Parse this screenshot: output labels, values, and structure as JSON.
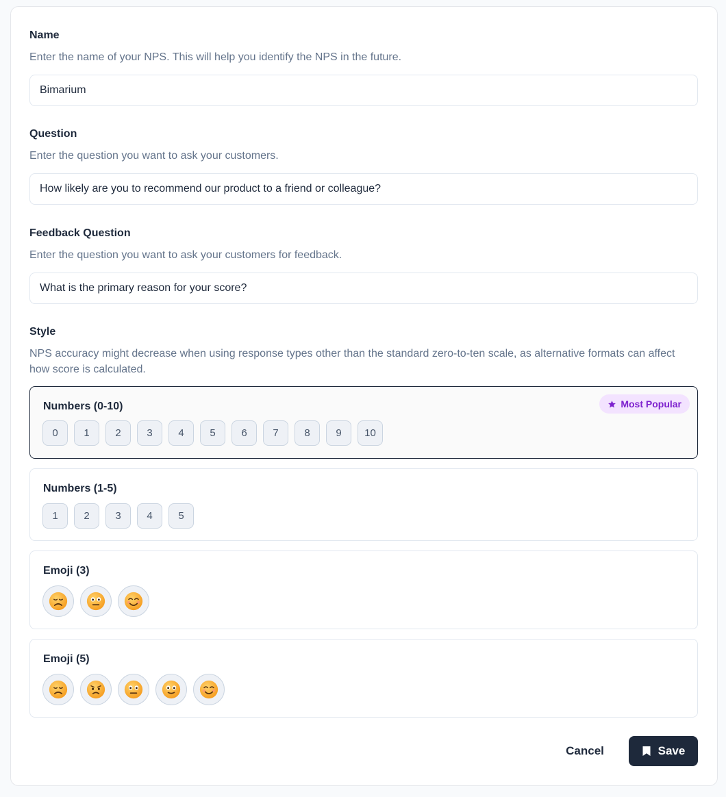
{
  "name": {
    "label": "Name",
    "description": "Enter the name of your NPS. This will help you identify the NPS in the future.",
    "value": "Bimarium"
  },
  "question": {
    "label": "Question",
    "description": "Enter the question you want to ask your customers.",
    "value": "How likely are you to recommend our product to a friend or colleague?"
  },
  "feedback": {
    "label": "Feedback Question",
    "description": "Enter the question you want to ask your customers for feedback.",
    "value": "What is the primary reason for your score?"
  },
  "style": {
    "label": "Style",
    "description": "NPS accuracy might decrease when using response types other than the standard zero-to-ten scale, as alternative formats can affect how score is calculated.",
    "options": [
      {
        "title": "Numbers (0-10)",
        "badge": "Most Popular",
        "selected": true,
        "chips": [
          "0",
          "1",
          "2",
          "3",
          "4",
          "5",
          "6",
          "7",
          "8",
          "9",
          "10"
        ]
      },
      {
        "title": "Numbers (1-5)",
        "selected": false,
        "chips": [
          "1",
          "2",
          "3",
          "4",
          "5"
        ]
      },
      {
        "title": "Emoji (3)",
        "selected": false,
        "emojis": [
          "sad-face-icon",
          "neutral-face-icon",
          "smiling-face-icon"
        ]
      },
      {
        "title": "Emoji (5)",
        "selected": false,
        "emojis": [
          "sad-face-icon",
          "frowning-face-icon",
          "neutral-face-icon",
          "slight-smile-face-icon",
          "smiling-face-icon"
        ]
      }
    ]
  },
  "footer": {
    "cancel_label": "Cancel",
    "save_label": "Save"
  },
  "colors": {
    "primary": "#1e293b",
    "badge_bg": "#f3e3ff",
    "badge_text": "#7e22ce",
    "muted_text": "#64748b"
  }
}
